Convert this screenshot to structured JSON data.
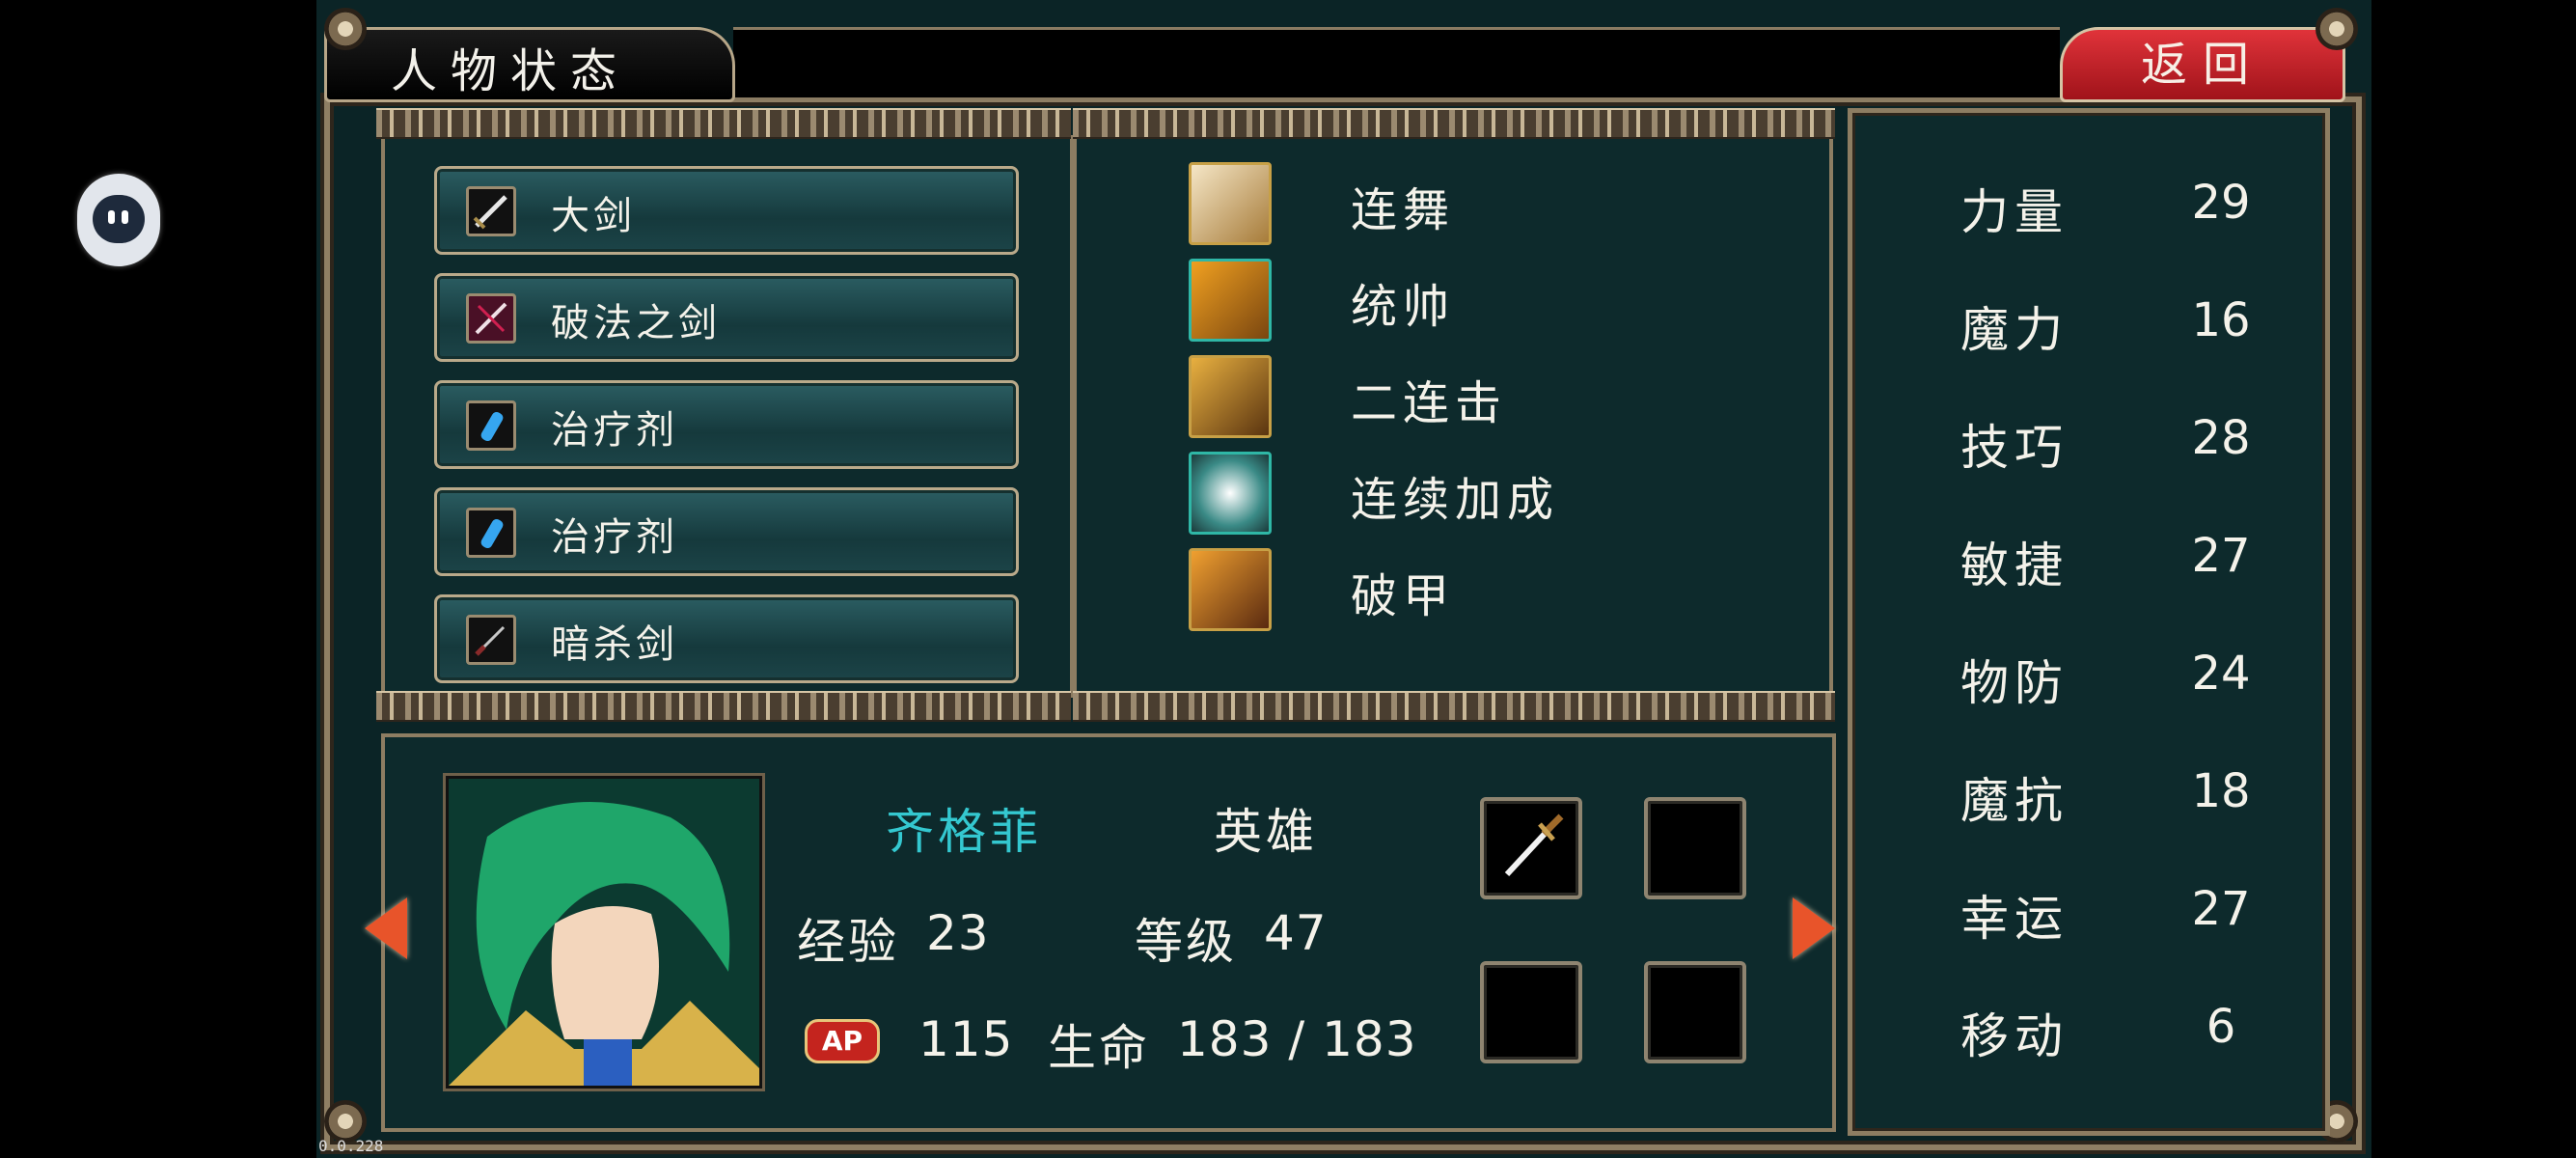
{
  "header": {
    "title": "人物状态",
    "back_label": "返回"
  },
  "items": [
    {
      "label": "大剑",
      "icon": "greatsword-icon"
    },
    {
      "label": "破法之剑",
      "icon": "spellbreaker-sword-icon"
    },
    {
      "label": "治疗剂",
      "icon": "potion-icon"
    },
    {
      "label": "治疗剂",
      "icon": "potion-icon"
    },
    {
      "label": "暗杀剑",
      "icon": "assassin-sword-icon"
    }
  ],
  "skills": [
    {
      "label": "连舞",
      "icon": "dance-combo-icon"
    },
    {
      "label": "统帅",
      "icon": "commander-icon"
    },
    {
      "label": "二连击",
      "icon": "double-strike-icon"
    },
    {
      "label": "连续加成",
      "icon": "combo-bonus-icon"
    },
    {
      "label": "破甲",
      "icon": "armor-break-icon"
    }
  ],
  "character": {
    "name": "齐格菲",
    "class": "英雄",
    "exp_label": "经验",
    "exp": "23",
    "level_label": "等级",
    "level": "47",
    "ap_badge": "AP",
    "ap": "115",
    "hp_label": "生命",
    "hp": "183 / 183"
  },
  "stats": [
    {
      "name": "力量",
      "value": "29"
    },
    {
      "name": "魔力",
      "value": "16"
    },
    {
      "name": "技巧",
      "value": "28"
    },
    {
      "name": "敏捷",
      "value": "27"
    },
    {
      "name": "物防",
      "value": "24"
    },
    {
      "name": "魔抗",
      "value": "18"
    },
    {
      "name": "幸运",
      "value": "27"
    },
    {
      "name": "移动",
      "value": "6"
    }
  ],
  "corner_text": "0.0.228",
  "colors": {
    "name_color": "#34c8d0",
    "back_button": "#c81e26",
    "panel_bg": "#0d2a2c",
    "frame": "#b9a98a"
  }
}
